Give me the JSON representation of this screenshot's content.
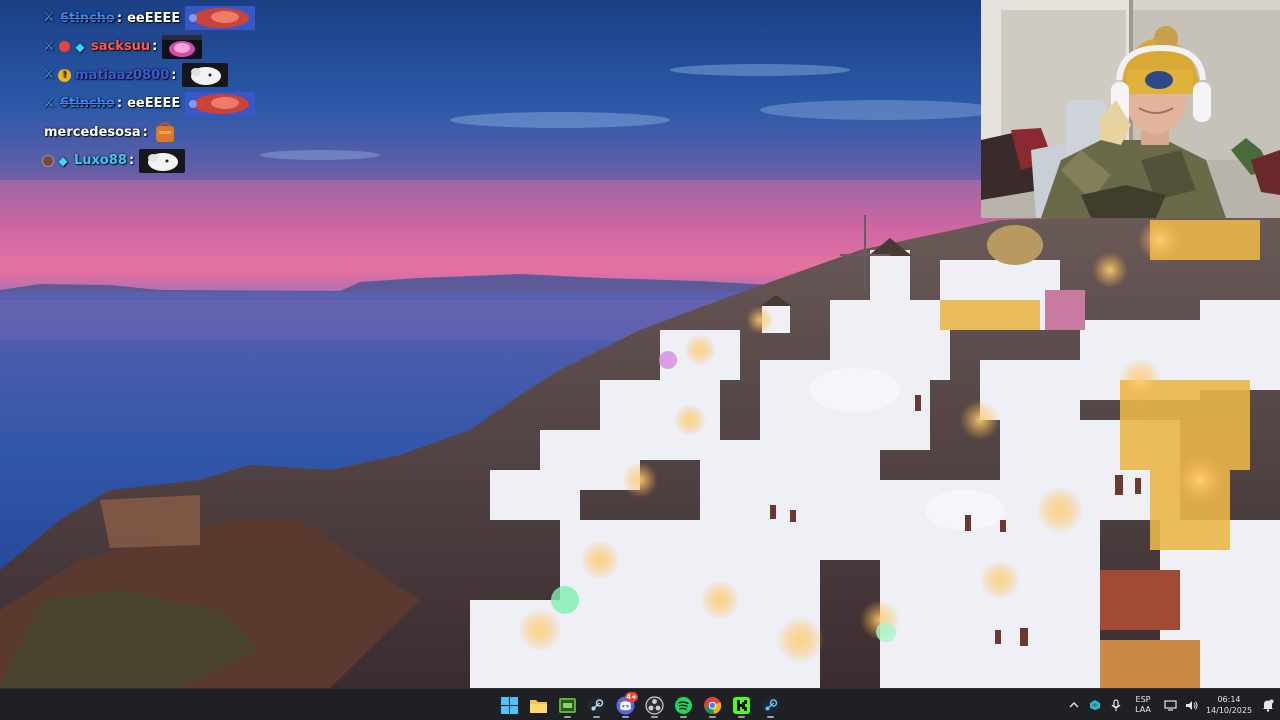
{
  "chat": {
    "messages": [
      {
        "user": "6tincho",
        "user_color": "#3c8cff",
        "strike": true,
        "badges": [
          "sword"
        ],
        "text": "eeEEEE",
        "emote": "red-face-emote"
      },
      {
        "user": "sacksuu",
        "user_color": "#ff5a45",
        "strike": false,
        "badges": [
          "sword",
          "red",
          "gem"
        ],
        "text": "",
        "emote": "pink-face-emote"
      },
      {
        "user": "matiaaz0800",
        "user_color": "#3d5ad8",
        "strike": false,
        "badges": [
          "sword",
          "gold"
        ],
        "text": "",
        "emote": "white-dog-emote"
      },
      {
        "user": "6tincho",
        "user_color": "#3c8cff",
        "strike": true,
        "badges": [
          "sword"
        ],
        "text": "eeEEEE",
        "emote": "red-face-emote"
      },
      {
        "user": "mercedesosa",
        "user_color": "#ffffff",
        "strike": false,
        "badges": [],
        "text": "",
        "emote": "orange-bag-emote"
      },
      {
        "user": "Luxo88",
        "user_color": "#35c8ff",
        "strike": false,
        "badges": [
          "face",
          "gem"
        ],
        "text": "",
        "emote": "white-dog-emote"
      }
    ]
  },
  "taskbar": {
    "apps": [
      {
        "name": "windows-start-icon",
        "active": false,
        "badge": ""
      },
      {
        "name": "file-explorer-icon",
        "active": false,
        "badge": ""
      },
      {
        "name": "xbox-app-icon",
        "active": true,
        "badge": ""
      },
      {
        "name": "steam-icon",
        "active": true,
        "badge": ""
      },
      {
        "name": "discord-icon",
        "active": true,
        "badge": "4+"
      },
      {
        "name": "obs-icon",
        "active": true,
        "badge": ""
      },
      {
        "name": "spotify-icon",
        "active": true,
        "badge": ""
      },
      {
        "name": "chrome-icon",
        "active": true,
        "badge": ""
      },
      {
        "name": "kick-icon",
        "active": true,
        "badge": ""
      },
      {
        "name": "steam-alt-icon",
        "active": true,
        "badge": ""
      }
    ],
    "tray": {
      "language_line1": "ESP",
      "language_line2": "LAA",
      "time": "06:14",
      "date": "14/10/2025"
    }
  },
  "colors": {
    "taskbar_bg": "#1f2024",
    "kick_green": "#53fc18",
    "discord_blurple": "#5865f2",
    "spotify_green": "#1ed760"
  }
}
